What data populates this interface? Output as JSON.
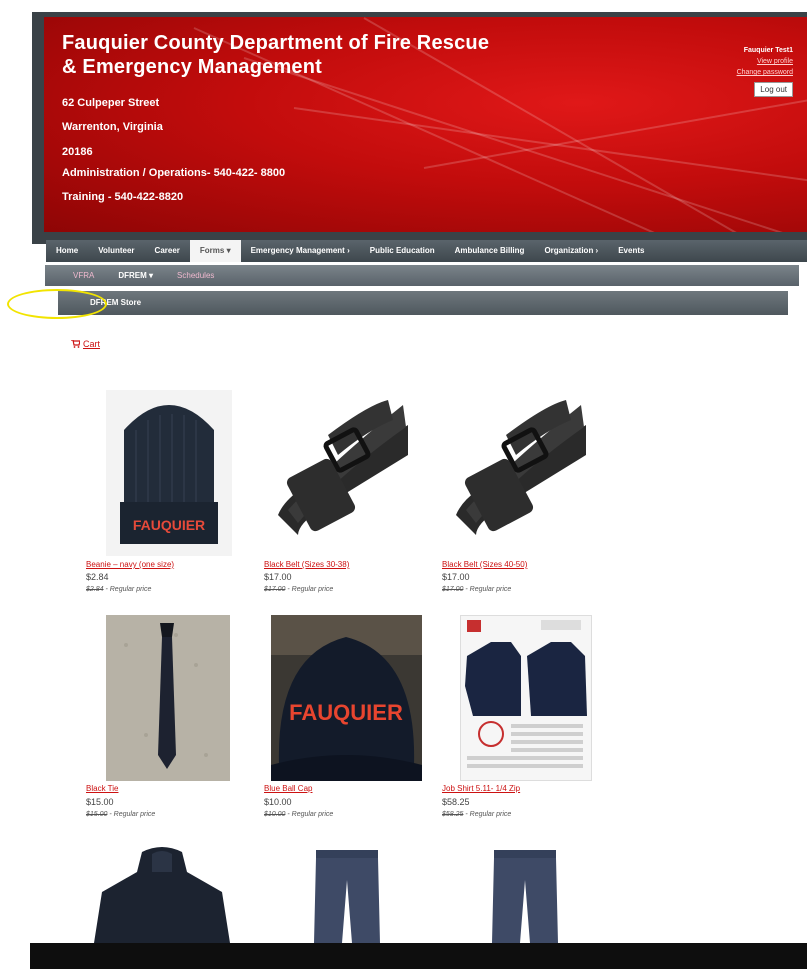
{
  "header": {
    "title_line1": "Fauquier County Department of Fire Rescue",
    "title_line2": "& Emergency Management",
    "address_street": "62 Culpeper Street",
    "address_city": "Warrenton, Virginia",
    "address_zip": "20186",
    "phone_admin": "Administration / Operations- 540-422- 8800",
    "phone_training": "Training - 540-422-8820"
  },
  "user": {
    "name": "Fauquier Test1",
    "view_profile": "View profile",
    "change_password": "Change password",
    "logout": "Log out"
  },
  "main_nav": [
    {
      "label": "Home"
    },
    {
      "label": "Volunteer"
    },
    {
      "label": "Career"
    },
    {
      "label": "Forms ▾"
    },
    {
      "label": "Emergency Management ›"
    },
    {
      "label": "Public Education"
    },
    {
      "label": "Ambulance Billing"
    },
    {
      "label": "Organization ›"
    },
    {
      "label": "Events"
    }
  ],
  "sub_nav": [
    {
      "label": "VFRA"
    },
    {
      "label": "DFREM ▾"
    },
    {
      "label": "Schedules"
    }
  ],
  "subsub_nav": {
    "label": "DFREM Store"
  },
  "cart": {
    "label": "Cart",
    "icon": "cart-icon"
  },
  "products": [
    {
      "name": "Beanie – navy (one size)",
      "price": "$2.84",
      "regular_price": "$2.84",
      "regular_suffix": " - Regular price"
    },
    {
      "name": "Black Belt (Sizes 30-38)",
      "price": "$17.00",
      "regular_price": "$17.00",
      "regular_suffix": " - Regular price"
    },
    {
      "name": "Black Belt (Sizes 40-50)",
      "price": "$17.00",
      "regular_price": "$17.00",
      "regular_suffix": " - Regular price"
    },
    {
      "name": "Black Tie",
      "price": "$15.00",
      "regular_price": "$15.00",
      "regular_suffix": " - Regular price"
    },
    {
      "name": "Blue Ball Cap",
      "price": "$10.00",
      "regular_price": "$10.00",
      "regular_suffix": " - Regular price"
    },
    {
      "name": "Job Shirt 5.11- 1/4 Zip",
      "price": "$58.25",
      "regular_price": "$58.25",
      "regular_suffix": " - Regular price"
    }
  ],
  "product_print": {
    "beanie_text": "FAUQUIER",
    "cap_text": "FAUQUIER"
  },
  "colors": {
    "banner_red": "#c20c0c",
    "link_red": "#cc1111",
    "nav_gray": "#4a5359",
    "highlight_yellow": "#f2e400"
  }
}
